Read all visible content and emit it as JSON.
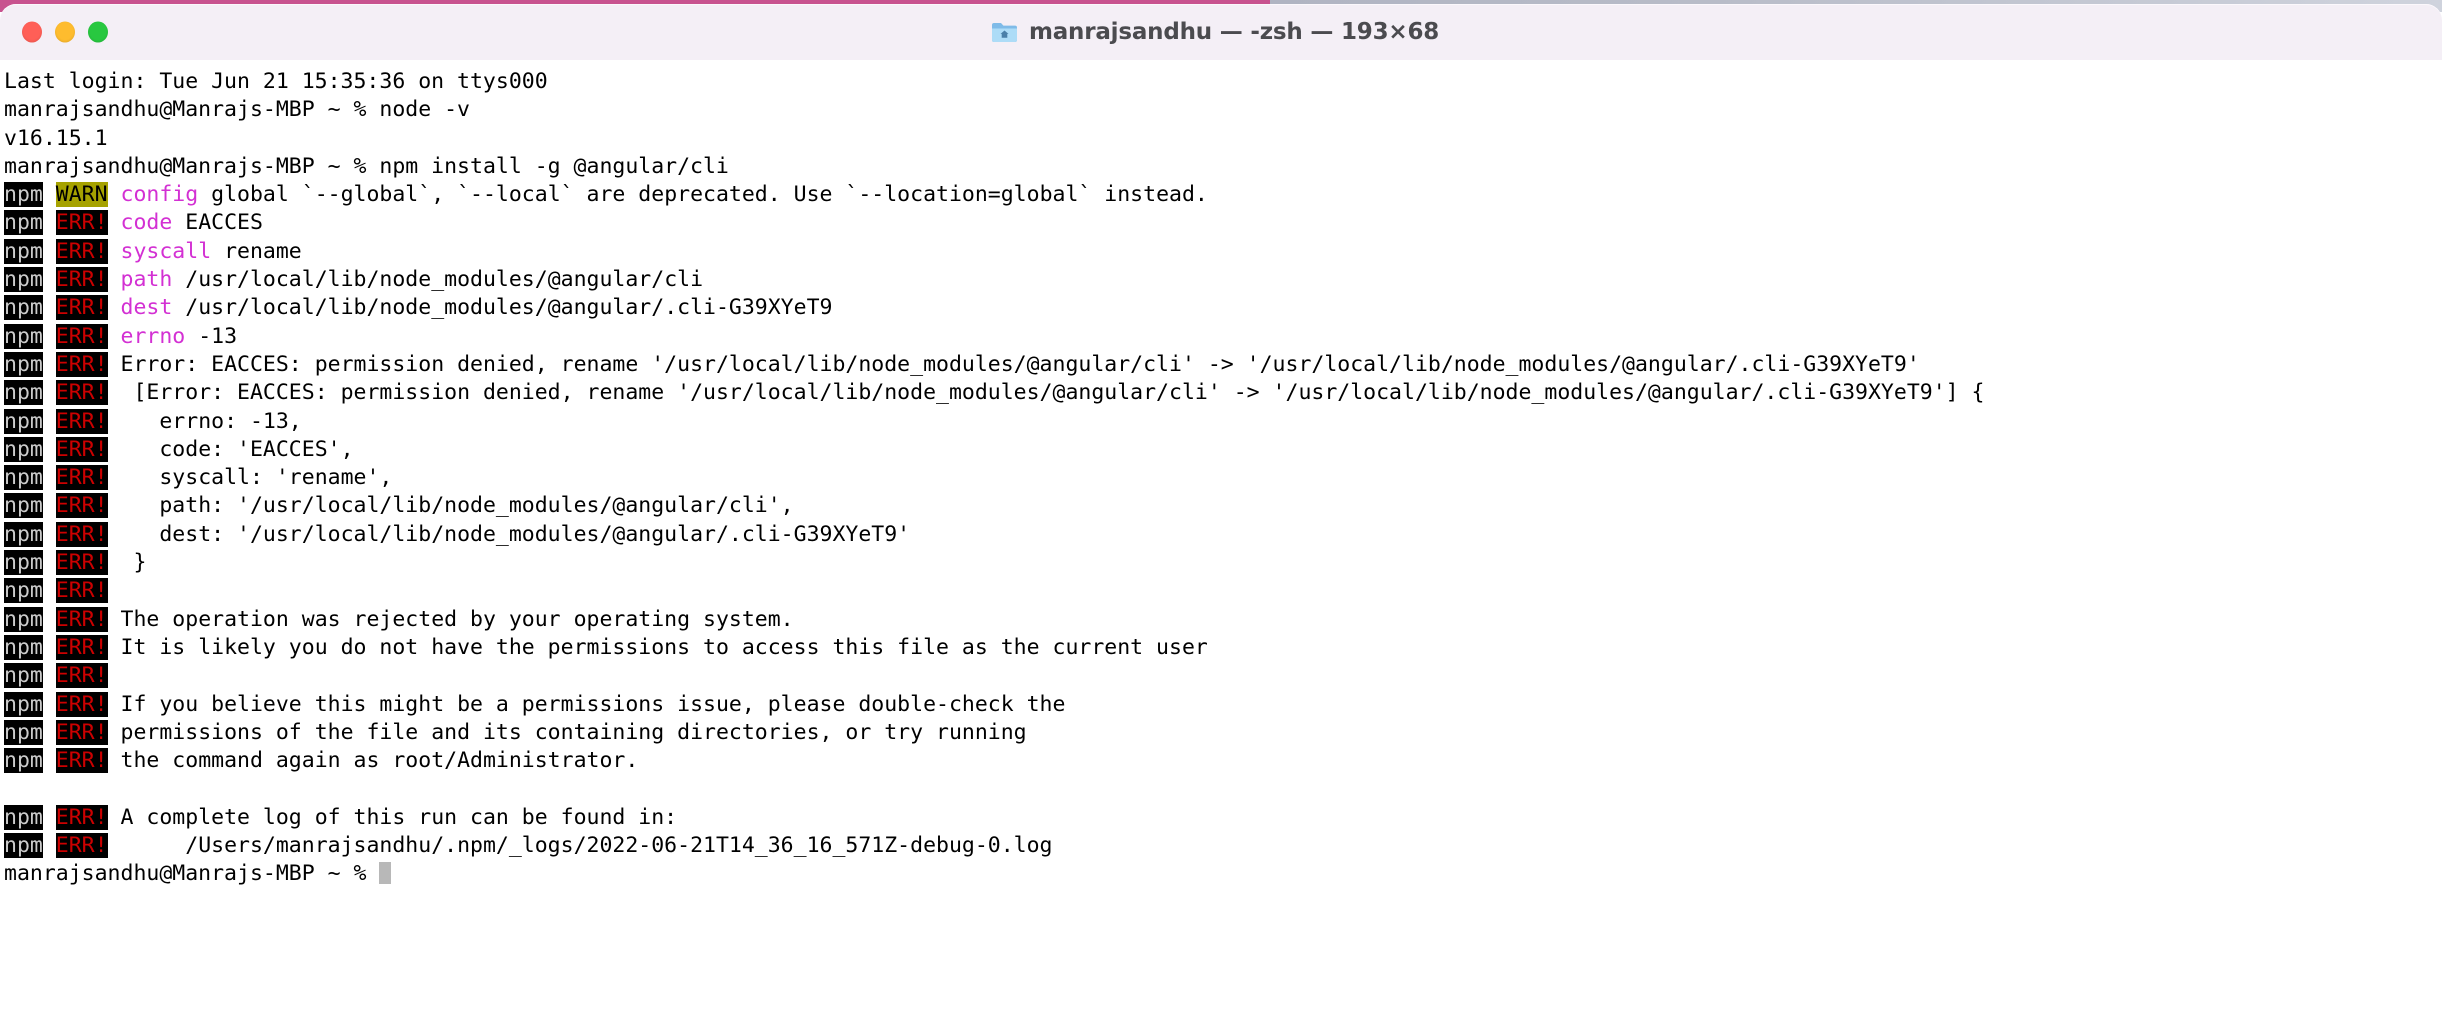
{
  "window": {
    "title": "manrajsandhu — -zsh — 193×68",
    "icon": "folder-home-icon",
    "controls": {
      "close": "close-button",
      "minimize": "minimize-button",
      "zoom": "zoom-button"
    },
    "colors": {
      "titlebar_bg": "#f4eff6",
      "title_text": "#4b4b4f",
      "close": "#ff5f57",
      "minimize": "#febc2e",
      "zoom": "#28c840",
      "terminal_bg": "#ffffff",
      "terminal_fg": "#000000",
      "magenta": "#d330d3",
      "warn_bg": "#a6a200",
      "err_fg": "#cc0000",
      "badge_bg": "#000000"
    }
  },
  "terminal": {
    "prompt": "manrajsandhu@Manrajs-MBP ~ % ",
    "badges": {
      "npm": "npm",
      "warn": "WARN",
      "err": "ERR!"
    },
    "lines": [
      {
        "type": "plain",
        "text": "Last login: Tue Jun 21 15:35:36 on ttys000"
      },
      {
        "type": "prompt",
        "command": "node -v"
      },
      {
        "type": "plain",
        "text": "v16.15.1"
      },
      {
        "type": "prompt",
        "command": "npm install -g @angular/cli"
      },
      {
        "type": "warn",
        "key": "config",
        "text": " global `--global`, `--local` are deprecated. Use `--location=global` instead."
      },
      {
        "type": "err",
        "key": "code",
        "text": " EACCES"
      },
      {
        "type": "err",
        "key": "syscall",
        "text": " rename"
      },
      {
        "type": "err",
        "key": "path",
        "text": " /usr/local/lib/node_modules/@angular/cli"
      },
      {
        "type": "err",
        "key": "dest",
        "text": " /usr/local/lib/node_modules/@angular/.cli-G39XYeT9"
      },
      {
        "type": "err",
        "key": "errno",
        "text": " -13"
      },
      {
        "type": "err",
        "key": "",
        "text": "Error: EACCES: permission denied, rename '/usr/local/lib/node_modules/@angular/cli' -> '/usr/local/lib/node_modules/@angular/.cli-G39XYeT9'"
      },
      {
        "type": "err",
        "key": "",
        "text": " [Error: EACCES: permission denied, rename '/usr/local/lib/node_modules/@angular/cli' -> '/usr/local/lib/node_modules/@angular/.cli-G39XYeT9'] {"
      },
      {
        "type": "err",
        "key": "",
        "text": "   errno: -13,"
      },
      {
        "type": "err",
        "key": "",
        "text": "   code: 'EACCES',"
      },
      {
        "type": "err",
        "key": "",
        "text": "   syscall: 'rename',"
      },
      {
        "type": "err",
        "key": "",
        "text": "   path: '/usr/local/lib/node_modules/@angular/cli',"
      },
      {
        "type": "err",
        "key": "",
        "text": "   dest: '/usr/local/lib/node_modules/@angular/.cli-G39XYeT9'"
      },
      {
        "type": "err",
        "key": "",
        "text": " }"
      },
      {
        "type": "err",
        "key": "",
        "text": ""
      },
      {
        "type": "err",
        "key": "",
        "text": "The operation was rejected by your operating system."
      },
      {
        "type": "err",
        "key": "",
        "text": "It is likely you do not have the permissions to access this file as the current user"
      },
      {
        "type": "err",
        "key": "",
        "text": ""
      },
      {
        "type": "err",
        "key": "",
        "text": "If you believe this might be a permissions issue, please double-check the"
      },
      {
        "type": "err",
        "key": "",
        "text": "permissions of the file and its containing directories, or try running"
      },
      {
        "type": "err",
        "key": "",
        "text": "the command again as root/Administrator."
      },
      {
        "type": "blank",
        "text": ""
      },
      {
        "type": "err",
        "key": "",
        "text": "A complete log of this run can be found in:"
      },
      {
        "type": "err",
        "key": "",
        "text": "     /Users/manrajsandhu/.npm/_logs/2022-06-21T14_36_16_571Z-debug-0.log"
      },
      {
        "type": "prompt-cursor",
        "command": ""
      }
    ]
  }
}
